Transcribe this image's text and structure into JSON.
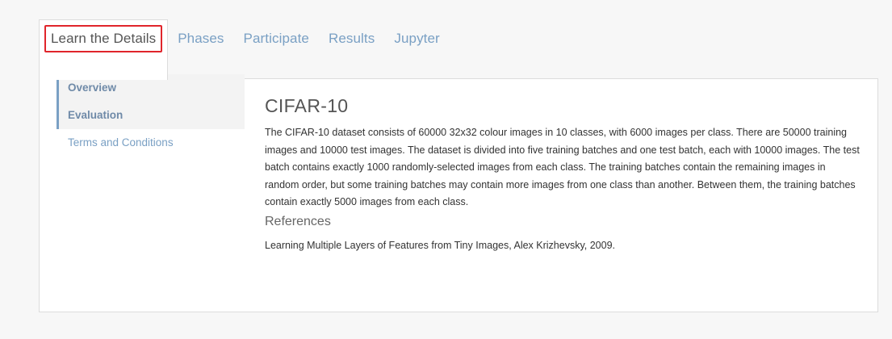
{
  "tabs": [
    {
      "label": "Learn the Details",
      "active": true
    },
    {
      "label": "Phases",
      "active": false
    },
    {
      "label": "Participate",
      "active": false
    },
    {
      "label": "Results",
      "active": false
    },
    {
      "label": "Jupyter",
      "active": false
    }
  ],
  "sidenav": {
    "items": [
      {
        "label": "Overview",
        "selected": true
      },
      {
        "label": "Evaluation",
        "selected": true
      },
      {
        "label": "Terms and Conditions",
        "selected": false
      }
    ]
  },
  "content": {
    "title": "CIFAR-10",
    "description": "The CIFAR-10 dataset consists of 60000 32x32 colour images in 10 classes, with 6000 images per class. There are 50000 training images and 10000 test images. The dataset is divided into five training batches and one test batch, each with 10000 images. The test batch contains exactly 1000 randomly-selected images from each class. The training batches contain the remaining images in random order, but some training batches may contain more images from one class than another. Between them, the training batches contain exactly 5000 images from each class.",
    "references_heading": "References",
    "reference_text": "Learning Multiple Layers of Features from Tiny Images, Alex Krizhevsky, 2009."
  },
  "colors": {
    "link": "#7aa0c4",
    "highlight_box": "#e0252b",
    "panel_border": "#dcdcdc",
    "page_background": "#f7f7f7"
  }
}
